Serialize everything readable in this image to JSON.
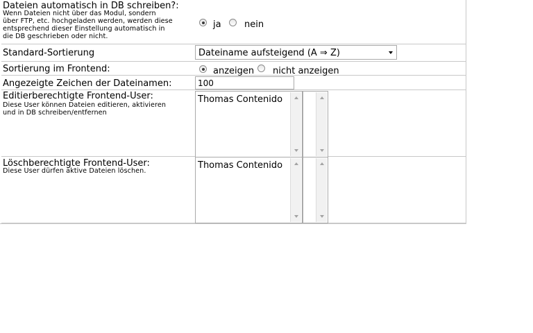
{
  "settings": {
    "auto_db": {
      "label": "Dateien automatisch in DB schreiben?:",
      "description_lines": [
        "Wenn Dateien nicht über das Modul, sondern",
        "über FTP, etc. hochgeladen werden, werden diese",
        "entsprechend dieser Einstellung automatisch in",
        "die DB geschrieben oder nicht."
      ],
      "options": [
        {
          "label": "ja",
          "checked": true
        },
        {
          "label": "nein",
          "checked": false
        }
      ]
    },
    "sorting": {
      "label": "Standard-Sortierung",
      "selected": "Dateiname aufsteigend (A ⇒ Z)"
    },
    "frontend_sorting": {
      "label": "Sortierung im Frontend:",
      "options": [
        {
          "label": "anzeigen",
          "checked": true
        },
        {
          "label": "nicht anzeigen",
          "checked": false
        }
      ]
    },
    "filename_chars": {
      "label": "Angezeigte Zeichen der Dateinamen:",
      "value": "100"
    },
    "edit_users": {
      "label": "Editierberechtigte Frontend-User:",
      "description_lines": [
        "Diese User können Dateien editieren, aktivieren",
        "und in DB schreiben/entfernen"
      ],
      "options": [
        "Thomas Contenido"
      ]
    },
    "delete_users": {
      "label": "Löschberechtigte Frontend-User:",
      "description_lines": [
        "Diese User dürfen aktive Dateien löschen."
      ],
      "options": [
        "Thomas Contenido"
      ]
    }
  }
}
